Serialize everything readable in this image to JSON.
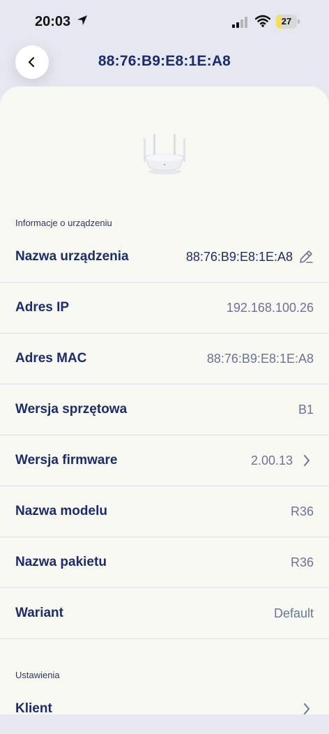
{
  "status_bar": {
    "time": "20:03",
    "battery": "27",
    "battery_level": 0.27
  },
  "header": {
    "title": "88:76:B9:E8:1E:A8"
  },
  "device_info": {
    "section_title": "Informacje o urządzeniu",
    "rows": [
      {
        "label": "Nazwa urządzenia",
        "value": "88:76:B9:E8:1E:A8"
      },
      {
        "label": "Adres IP",
        "value": "192.168.100.26"
      },
      {
        "label": "Adres MAC",
        "value": "88:76:B9:E8:1E:A8"
      },
      {
        "label": "Wersja sprzętowa",
        "value": "B1"
      },
      {
        "label": "Wersja firmware",
        "value": "2.00.13"
      },
      {
        "label": "Nazwa modelu",
        "value": "R36"
      },
      {
        "label": "Nazwa pakietu",
        "value": "R36"
      },
      {
        "label": "Wariant",
        "value": "Default"
      }
    ]
  },
  "settings": {
    "section_title": "Ustawienia",
    "rows": [
      {
        "label": "Klient"
      }
    ]
  }
}
